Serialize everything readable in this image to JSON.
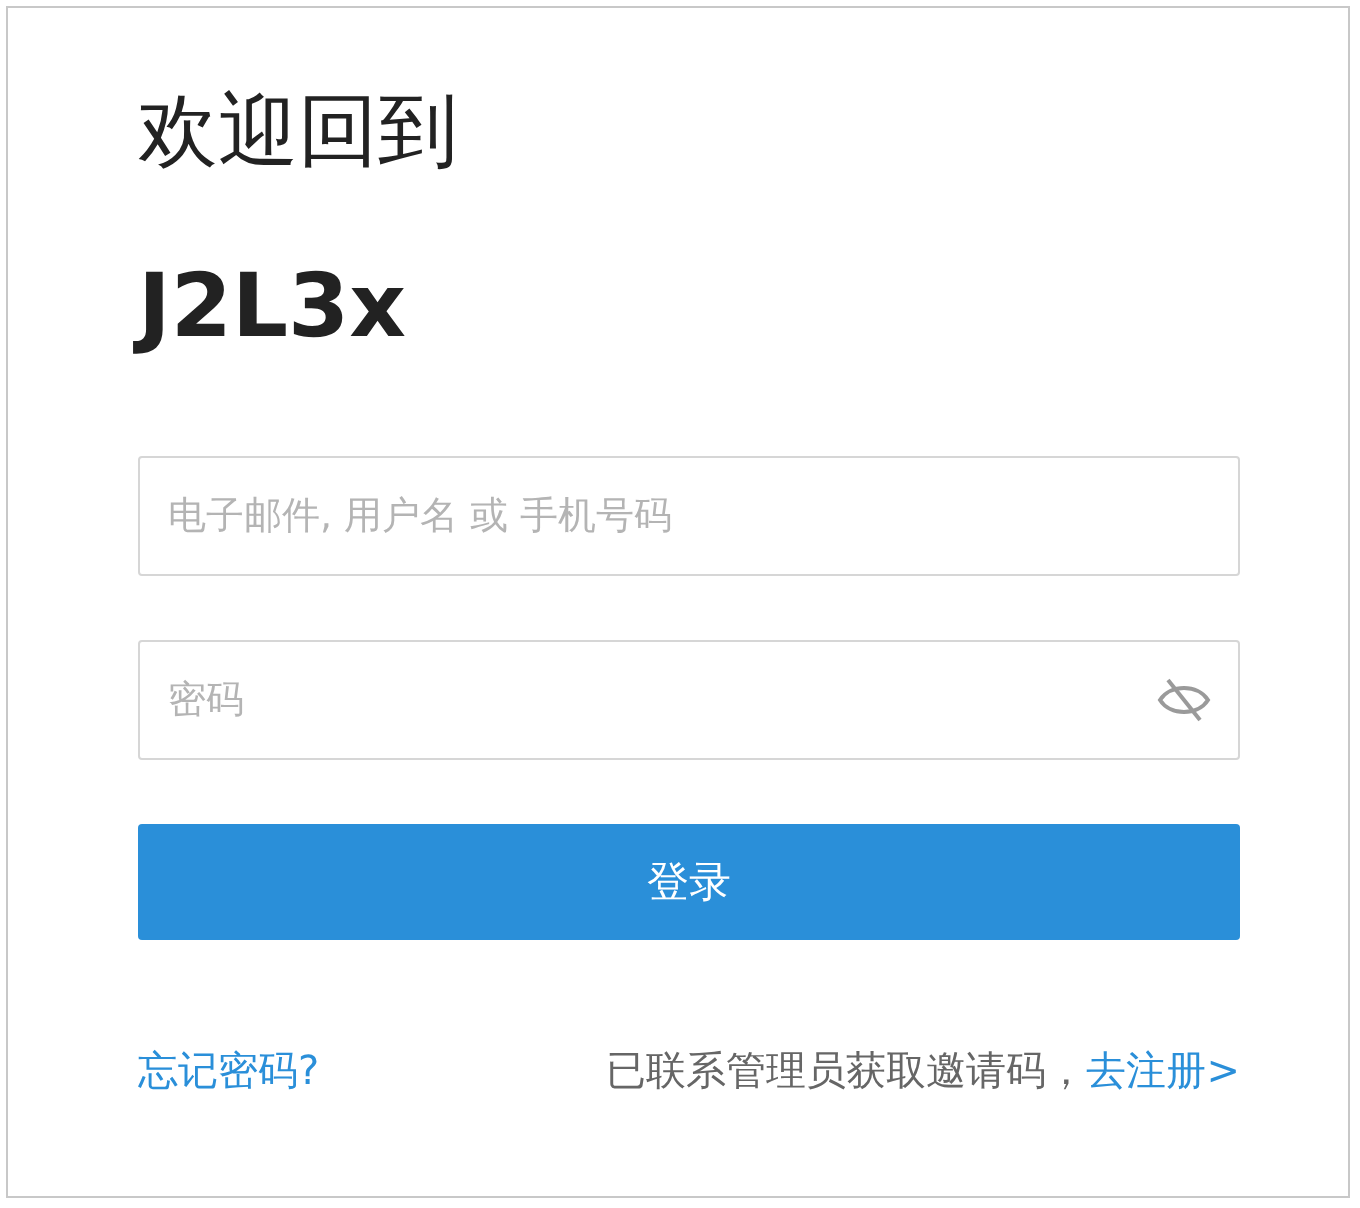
{
  "heading": "欢迎回到",
  "brand": "J2L3x",
  "username": {
    "placeholder": "电子邮件, 用户名 或 手机号码"
  },
  "password": {
    "placeholder": "密码",
    "visible": false
  },
  "submit": "登录",
  "footer": {
    "forgot": "忘记密码?",
    "invite_note": "已联系管理员获取邀请码，",
    "register": "去注册>"
  }
}
